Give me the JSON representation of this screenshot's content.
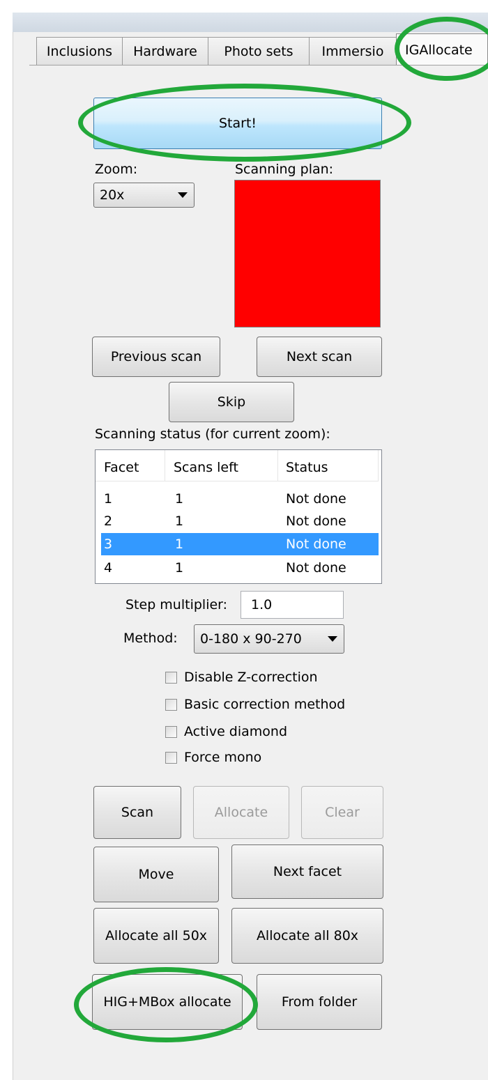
{
  "tabs": [
    {
      "label": "Inclusions",
      "active": false
    },
    {
      "label": "Hardware",
      "active": false
    },
    {
      "label": "Photo sets",
      "active": false
    },
    {
      "label": "Immersio",
      "active": false
    },
    {
      "label": "IGAllocate",
      "active": true
    }
  ],
  "start_button": "Start!",
  "zoom": {
    "label": "Zoom:",
    "value": "20x"
  },
  "scanning_plan": {
    "label": "Scanning plan:",
    "color": "#ff0000"
  },
  "nav": {
    "previous": "Previous scan",
    "next": "Next scan",
    "skip": "Skip"
  },
  "status": {
    "label": "Scanning status (for current zoom):",
    "columns": [
      "Facet",
      "Scans left",
      "Status"
    ],
    "rows": [
      {
        "facet": "1",
        "scans_left": "1",
        "status": "Not done"
      },
      {
        "facet": "2",
        "scans_left": "1",
        "status": "Not done"
      },
      {
        "facet": "3",
        "scans_left": "1",
        "status": "Not done",
        "selected": true
      },
      {
        "facet": "4",
        "scans_left": "1",
        "status": "Not done"
      }
    ]
  },
  "step_multiplier": {
    "label": "Step multiplier:",
    "value": "1.0"
  },
  "method": {
    "label": "Method:",
    "value": "0-180 x 90-270"
  },
  "options": [
    {
      "label": "Disable Z-correction",
      "checked": false
    },
    {
      "label": "Basic correction method",
      "checked": false
    },
    {
      "label": "Active diamond",
      "checked": false
    },
    {
      "label": "Force mono",
      "checked": false
    }
  ],
  "actions": {
    "scan": "Scan",
    "allocate": "Allocate",
    "clear": "Clear",
    "move": "Move",
    "next_facet": "Next facet",
    "allocate_50x": "Allocate all 50x",
    "allocate_80x": "Allocate all 80x",
    "hig_mbox": "HIG+MBox allocate",
    "from_folder": "From folder"
  },
  "highlight_color": "#22a83a"
}
